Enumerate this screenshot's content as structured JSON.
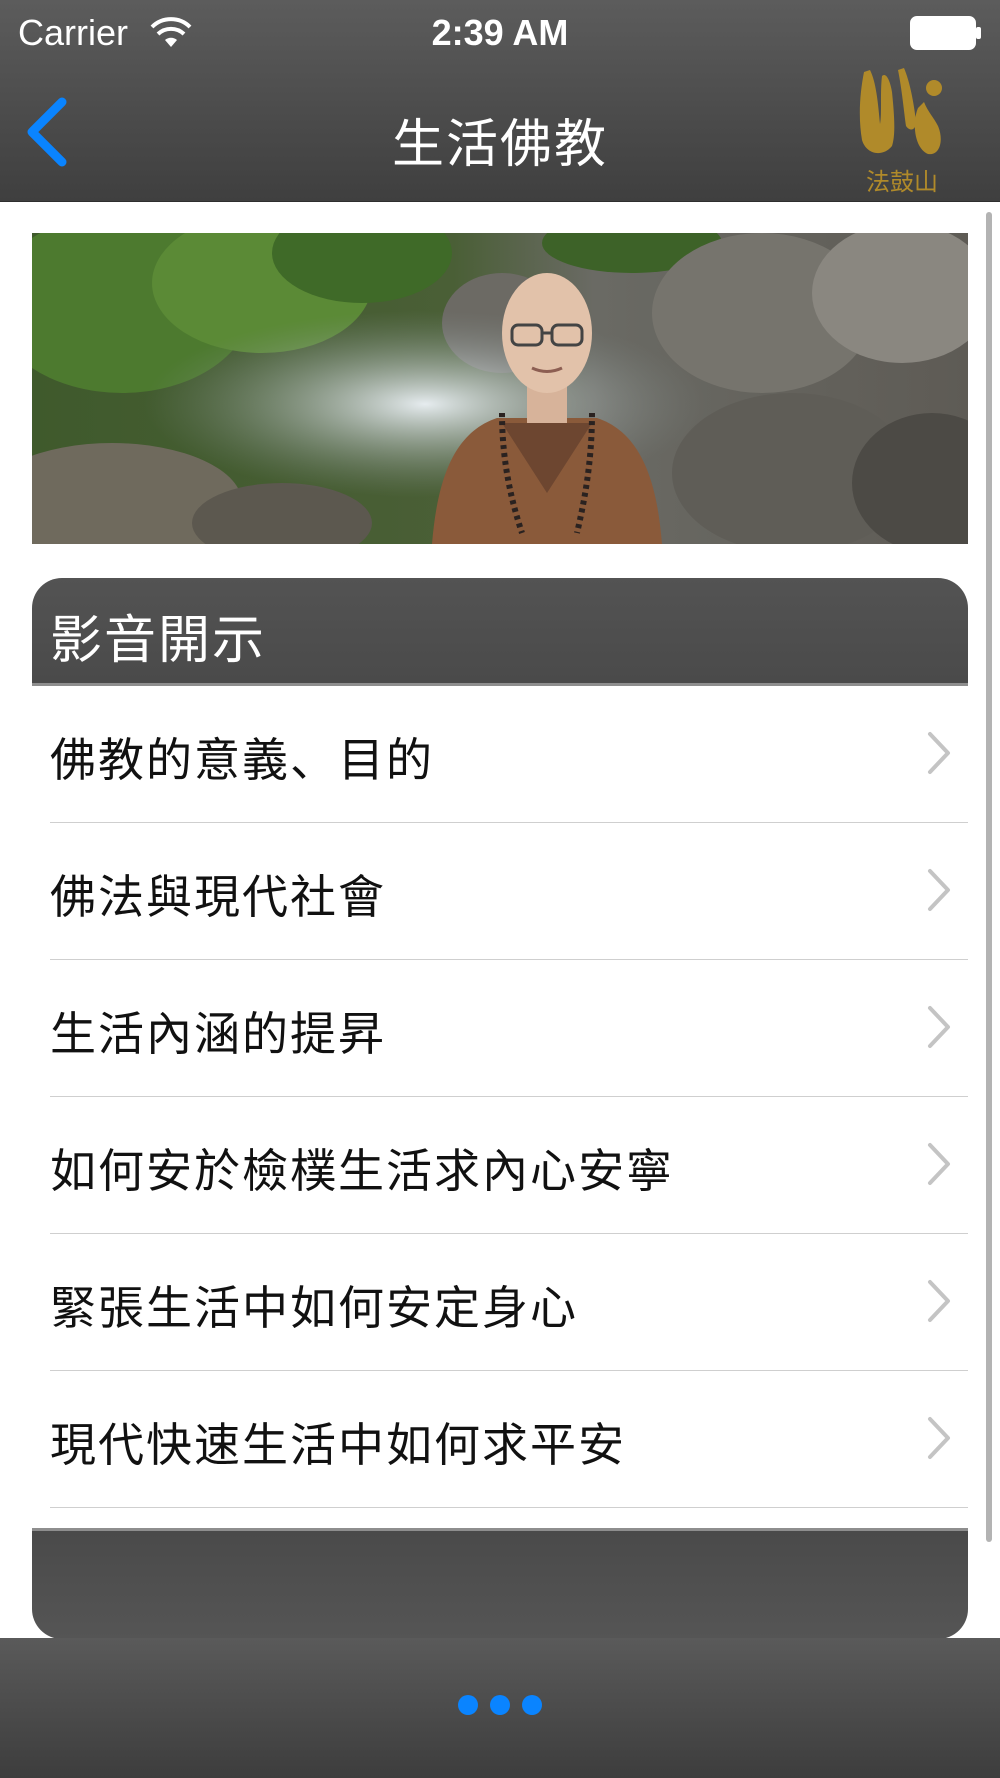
{
  "status_bar": {
    "carrier": "Carrier",
    "time": "2:39 AM"
  },
  "nav": {
    "title": "生活佛教",
    "back_icon": "chevron-left-icon",
    "logo_text": "法鼓山"
  },
  "banner": {
    "description_icon": "monk-portrait-photo"
  },
  "section": {
    "header": "影音開示",
    "items": [
      {
        "label": "佛教的意義、目的"
      },
      {
        "label": "佛法與現代社會"
      },
      {
        "label": "生活內涵的提昇"
      },
      {
        "label": "如何安於檢樸生活求內心安寧"
      },
      {
        "label": "緊張生活中如何安定身心"
      },
      {
        "label": "現代快速生活中如何求平安"
      }
    ]
  },
  "pager": {
    "count": 3
  },
  "colors": {
    "accent": "#0a84ff",
    "bar": "#4a4a4a",
    "logo_gold": "#b08a2a"
  }
}
